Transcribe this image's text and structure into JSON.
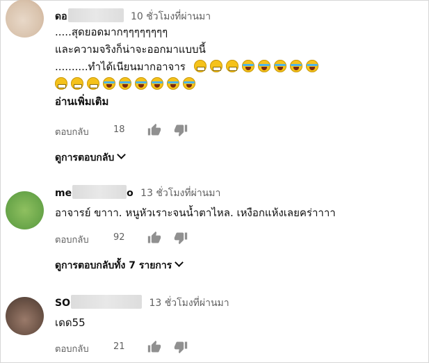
{
  "comments": [
    {
      "author": "ดอ",
      "time": "10 ชั่วโมงที่ผ่านมา",
      "lines": [
        ".....สุดยอดมากๆๆๆๆๆๆๆๆ",
        "และความจริงก็น่าจะออกมาแบบนี้",
        "..........ทำได้เนียนมากอาจาร"
      ],
      "emoji_row1": [
        "grin",
        "grin",
        "grin",
        "laugh",
        "laugh",
        "laugh",
        "laugh",
        "laugh"
      ],
      "emoji_row2": [
        "grin",
        "grin",
        "grin",
        "laugh",
        "laugh",
        "laugh",
        "laugh",
        "laugh",
        "laugh"
      ],
      "read_more": "อ่านเพิ่มเติม",
      "reply_label": "ตอบกลับ",
      "likes": "18",
      "view_replies": "ดูการตอบกลับ"
    },
    {
      "author": "me",
      "author_tail": "o",
      "time": "13 ชั่วโมงที่ผ่านมา",
      "text": "อาจารย์ ขาาา. หนูหัวเราะจนน้ำตาไหล. เหงือกแห้งเลยคร่าาาา",
      "reply_label": "ตอบกลับ",
      "likes": "92",
      "view_replies": "ดูการตอบกลับทั้ง 7 รายการ"
    },
    {
      "author": "SO",
      "time": "13 ชั่วโมงที่ผ่านมา",
      "text": "เดด55",
      "reply_label": "ตอบกลับ",
      "likes": "21"
    }
  ],
  "icons": {
    "like": "thumbs-up-icon",
    "dislike": "thumbs-down-icon",
    "expand": "chevron-down-icon"
  },
  "colors": {
    "secondary_text": "#606060",
    "primary_text": "#0f0f0f",
    "icon": "#909090"
  }
}
